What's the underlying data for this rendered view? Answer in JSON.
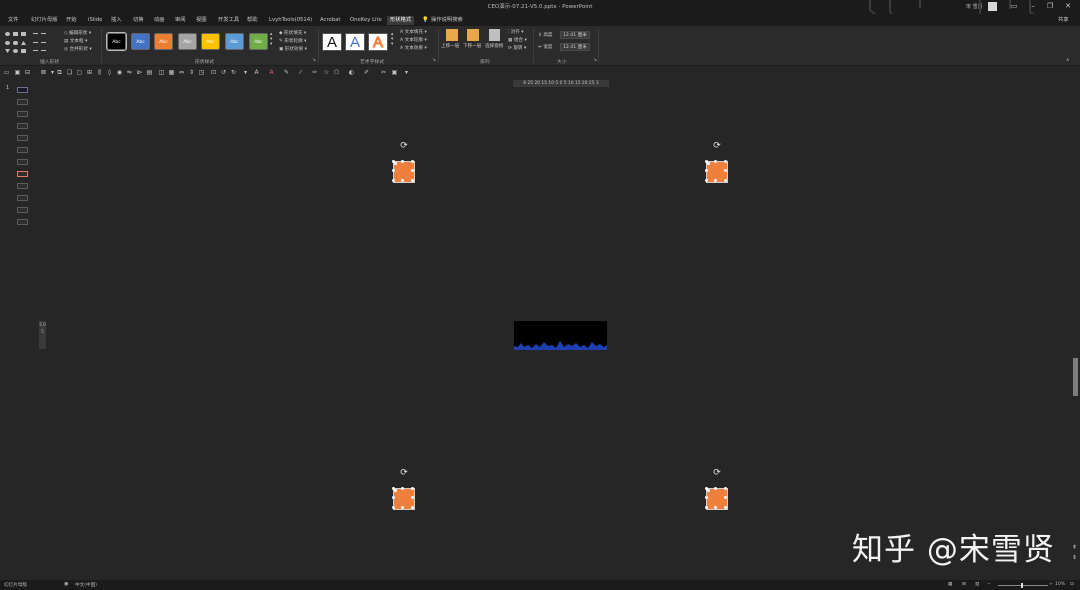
{
  "window": {
    "title": "CEO演示-07.21-V5.0.pptx - PowerPoint",
    "user_name": "宋 雪贤",
    "min_icon": "minimize-icon",
    "max_icon": "restore-icon",
    "close_icon": "close-icon"
  },
  "tabs": [
    {
      "label": "文件"
    },
    {
      "label": "幻灯片母版"
    },
    {
      "label": "开始"
    },
    {
      "label": "iSlide"
    },
    {
      "label": "插入"
    },
    {
      "label": "切换"
    },
    {
      "label": "动画"
    },
    {
      "label": "审阅"
    },
    {
      "label": "视图"
    },
    {
      "label": "开发工具"
    },
    {
      "label": "帮助"
    },
    {
      "label": "LvyhTools(0514)"
    },
    {
      "label": "Acrobat"
    },
    {
      "label": "OneKey Lite"
    },
    {
      "label": "形状格式",
      "active": true
    },
    {
      "label": "操作说明搜索"
    }
  ],
  "share_label": "共享",
  "ribbon": {
    "insert_shapes": {
      "label": "插入形状",
      "edit_shape": "编辑形状",
      "text_box": "文本框",
      "merge_shapes": "合并形状"
    },
    "shape_styles": {
      "label": "形状样式",
      "swatches": [
        {
          "text": "Abc",
          "color": "#000000"
        },
        {
          "text": "Abc",
          "color": "#4472c4"
        },
        {
          "text": "Abc",
          "color": "#ed7d31"
        },
        {
          "text": "Abc",
          "color": "#a5a5a5"
        },
        {
          "text": "Abc",
          "color": "#ffc000"
        },
        {
          "text": "Abc",
          "color": "#5b9bd5"
        },
        {
          "text": "Abc",
          "color": "#70ad47"
        }
      ],
      "fill": "形状填充",
      "outline": "形状轮廓",
      "effects": "形状效果"
    },
    "wordart_styles": {
      "label": "艺术字样式",
      "letters": [
        "A",
        "A",
        "A"
      ],
      "text_fill": "文本填充",
      "text_outline": "文本轮廓",
      "text_effects": "文本效果"
    },
    "arrange": {
      "label": "排列",
      "bring_forward": "上移一层",
      "send_backward": "下移一层",
      "selection_pane": "选择窗格",
      "align": "对齐",
      "group": "组合",
      "rotate": "旋转"
    },
    "size": {
      "label": "大小",
      "height_label": "高度",
      "height_value": "12.41 厘米",
      "width_label": "宽度",
      "width_value": "12.41 厘米"
    }
  },
  "ruler": {
    "horizontal": "8 25 20 15 10 5  0  5 10 15 20 25 3",
    "vertical": "5 0 5"
  },
  "thumbnails": {
    "first_number": "1"
  },
  "watermark": "知乎 @宋雪贤",
  "status": {
    "slide_count": "幻灯片母版",
    "language": "中文(中国)",
    "zoom": "10%"
  }
}
